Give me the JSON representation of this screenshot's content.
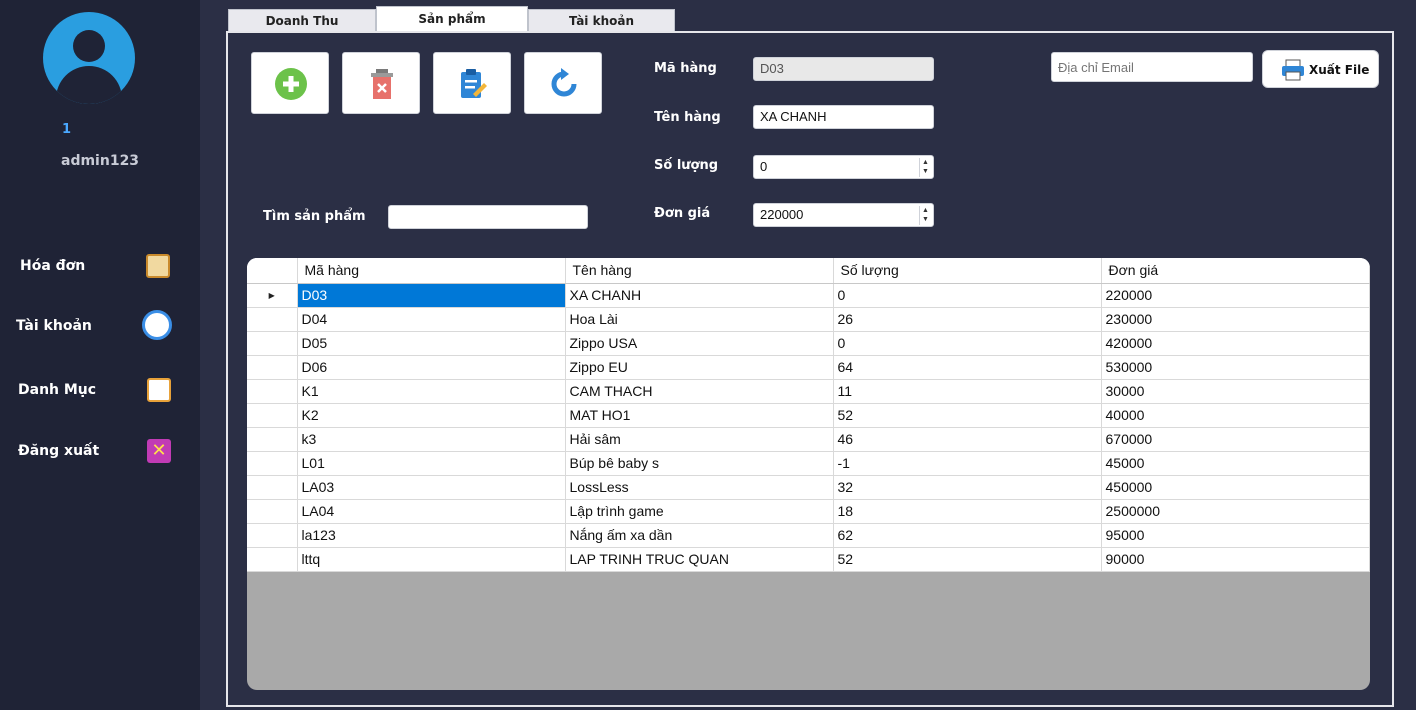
{
  "sidebar": {
    "user_id": "1",
    "username": "admin123",
    "items": [
      {
        "label": "Hóa đơn",
        "icon": "invoice-icon"
      },
      {
        "label": "Tài khoản",
        "icon": "user-account-icon"
      },
      {
        "label": "Danh Mục",
        "icon": "checklist-icon"
      },
      {
        "label": "Đăng xuất",
        "icon": "logout-x-icon"
      }
    ]
  },
  "tabs": [
    {
      "label": "Doanh Thu",
      "active": false
    },
    {
      "label": "Sản phẩm",
      "active": true
    },
    {
      "label": "Tài khoản",
      "active": false
    }
  ],
  "toolbar": [
    {
      "name": "add-button",
      "icon": "plus-icon"
    },
    {
      "name": "delete-button",
      "icon": "trash-icon"
    },
    {
      "name": "edit-button",
      "icon": "clipboard-edit-icon"
    },
    {
      "name": "refresh-button",
      "icon": "refresh-icon"
    }
  ],
  "search": {
    "label": "Tìm sản phẩm",
    "value": ""
  },
  "form": {
    "ma_hang_label": "Mã hàng",
    "ma_hang_value": "D03",
    "ten_hang_label": "Tên hàng",
    "ten_hang_value": "XA CHANH",
    "so_luong_label": "Số lượng",
    "so_luong_value": "0",
    "don_gia_label": "Đơn giá",
    "don_gia_value": "220000"
  },
  "email": {
    "placeholder": "Địa chỉ Email"
  },
  "export": {
    "label": "Xuất File"
  },
  "colors": {
    "accent": "#2a9ee0",
    "selection": "#0078d7",
    "sidebar": "#1f2336",
    "background": "#2b2f45"
  },
  "grid": {
    "columns": [
      "Mã hàng",
      "Tên hàng",
      "Số lượng",
      "Đơn giá"
    ],
    "rows": [
      [
        "D03",
        "XA CHANH",
        "0",
        "220000"
      ],
      [
        "D04",
        "Hoa Lài",
        "26",
        "230000"
      ],
      [
        "D05",
        "Zippo USA",
        "0",
        "420000"
      ],
      [
        "D06",
        "Zippo EU",
        "64",
        "530000"
      ],
      [
        "K1",
        "CAM THACH",
        "11",
        "30000"
      ],
      [
        "K2",
        "MAT HO1",
        "52",
        "40000"
      ],
      [
        "k3",
        "Hải sâm",
        "46",
        "670000"
      ],
      [
        "L01",
        "Búp bê baby s",
        "-1",
        "45000"
      ],
      [
        "LA03",
        "LossLess",
        "32",
        "450000"
      ],
      [
        "LA04",
        "Lập trình game",
        "18",
        "2500000"
      ],
      [
        "la123",
        "Nắng ấm xa dần",
        "62",
        "95000"
      ],
      [
        "lttq",
        "LAP TRINH TRUC QUAN",
        "52",
        "90000"
      ]
    ],
    "selected_row": 0
  }
}
